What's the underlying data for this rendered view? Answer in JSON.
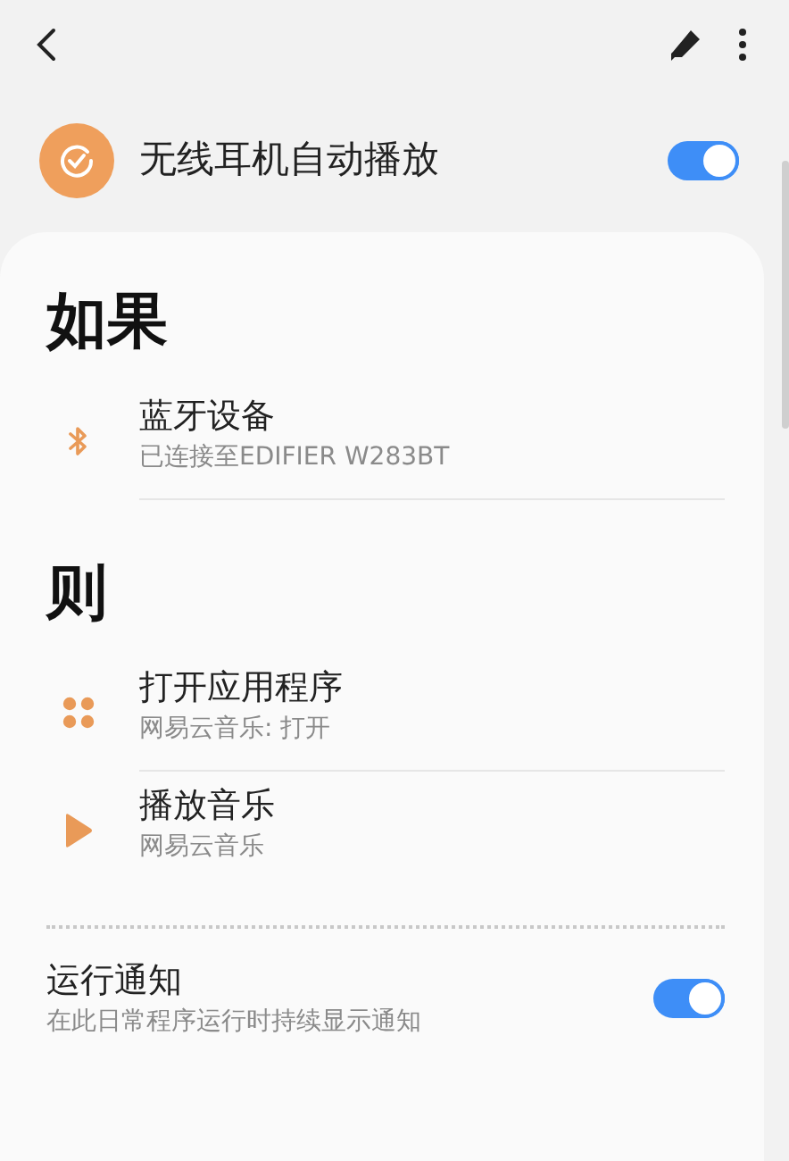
{
  "routine": {
    "title": "无线耳机自动播放",
    "on": true
  },
  "sections": [
    {
      "heading": "如果",
      "items": [
        {
          "kind": "bluetooth",
          "title": "蓝牙设备",
          "subtitle": "已连接至EDIFIER W283BT"
        }
      ]
    },
    {
      "heading": "则",
      "items": [
        {
          "kind": "apps",
          "title": "打开应用程序",
          "subtitle": "网易云音乐: 打开"
        },
        {
          "kind": "play",
          "title": "播放音乐",
          "subtitle": "网易云音乐"
        }
      ]
    }
  ],
  "notification": {
    "title": "运行通知",
    "subtitle": "在此日常程序运行时持续显示通知",
    "on": true
  }
}
